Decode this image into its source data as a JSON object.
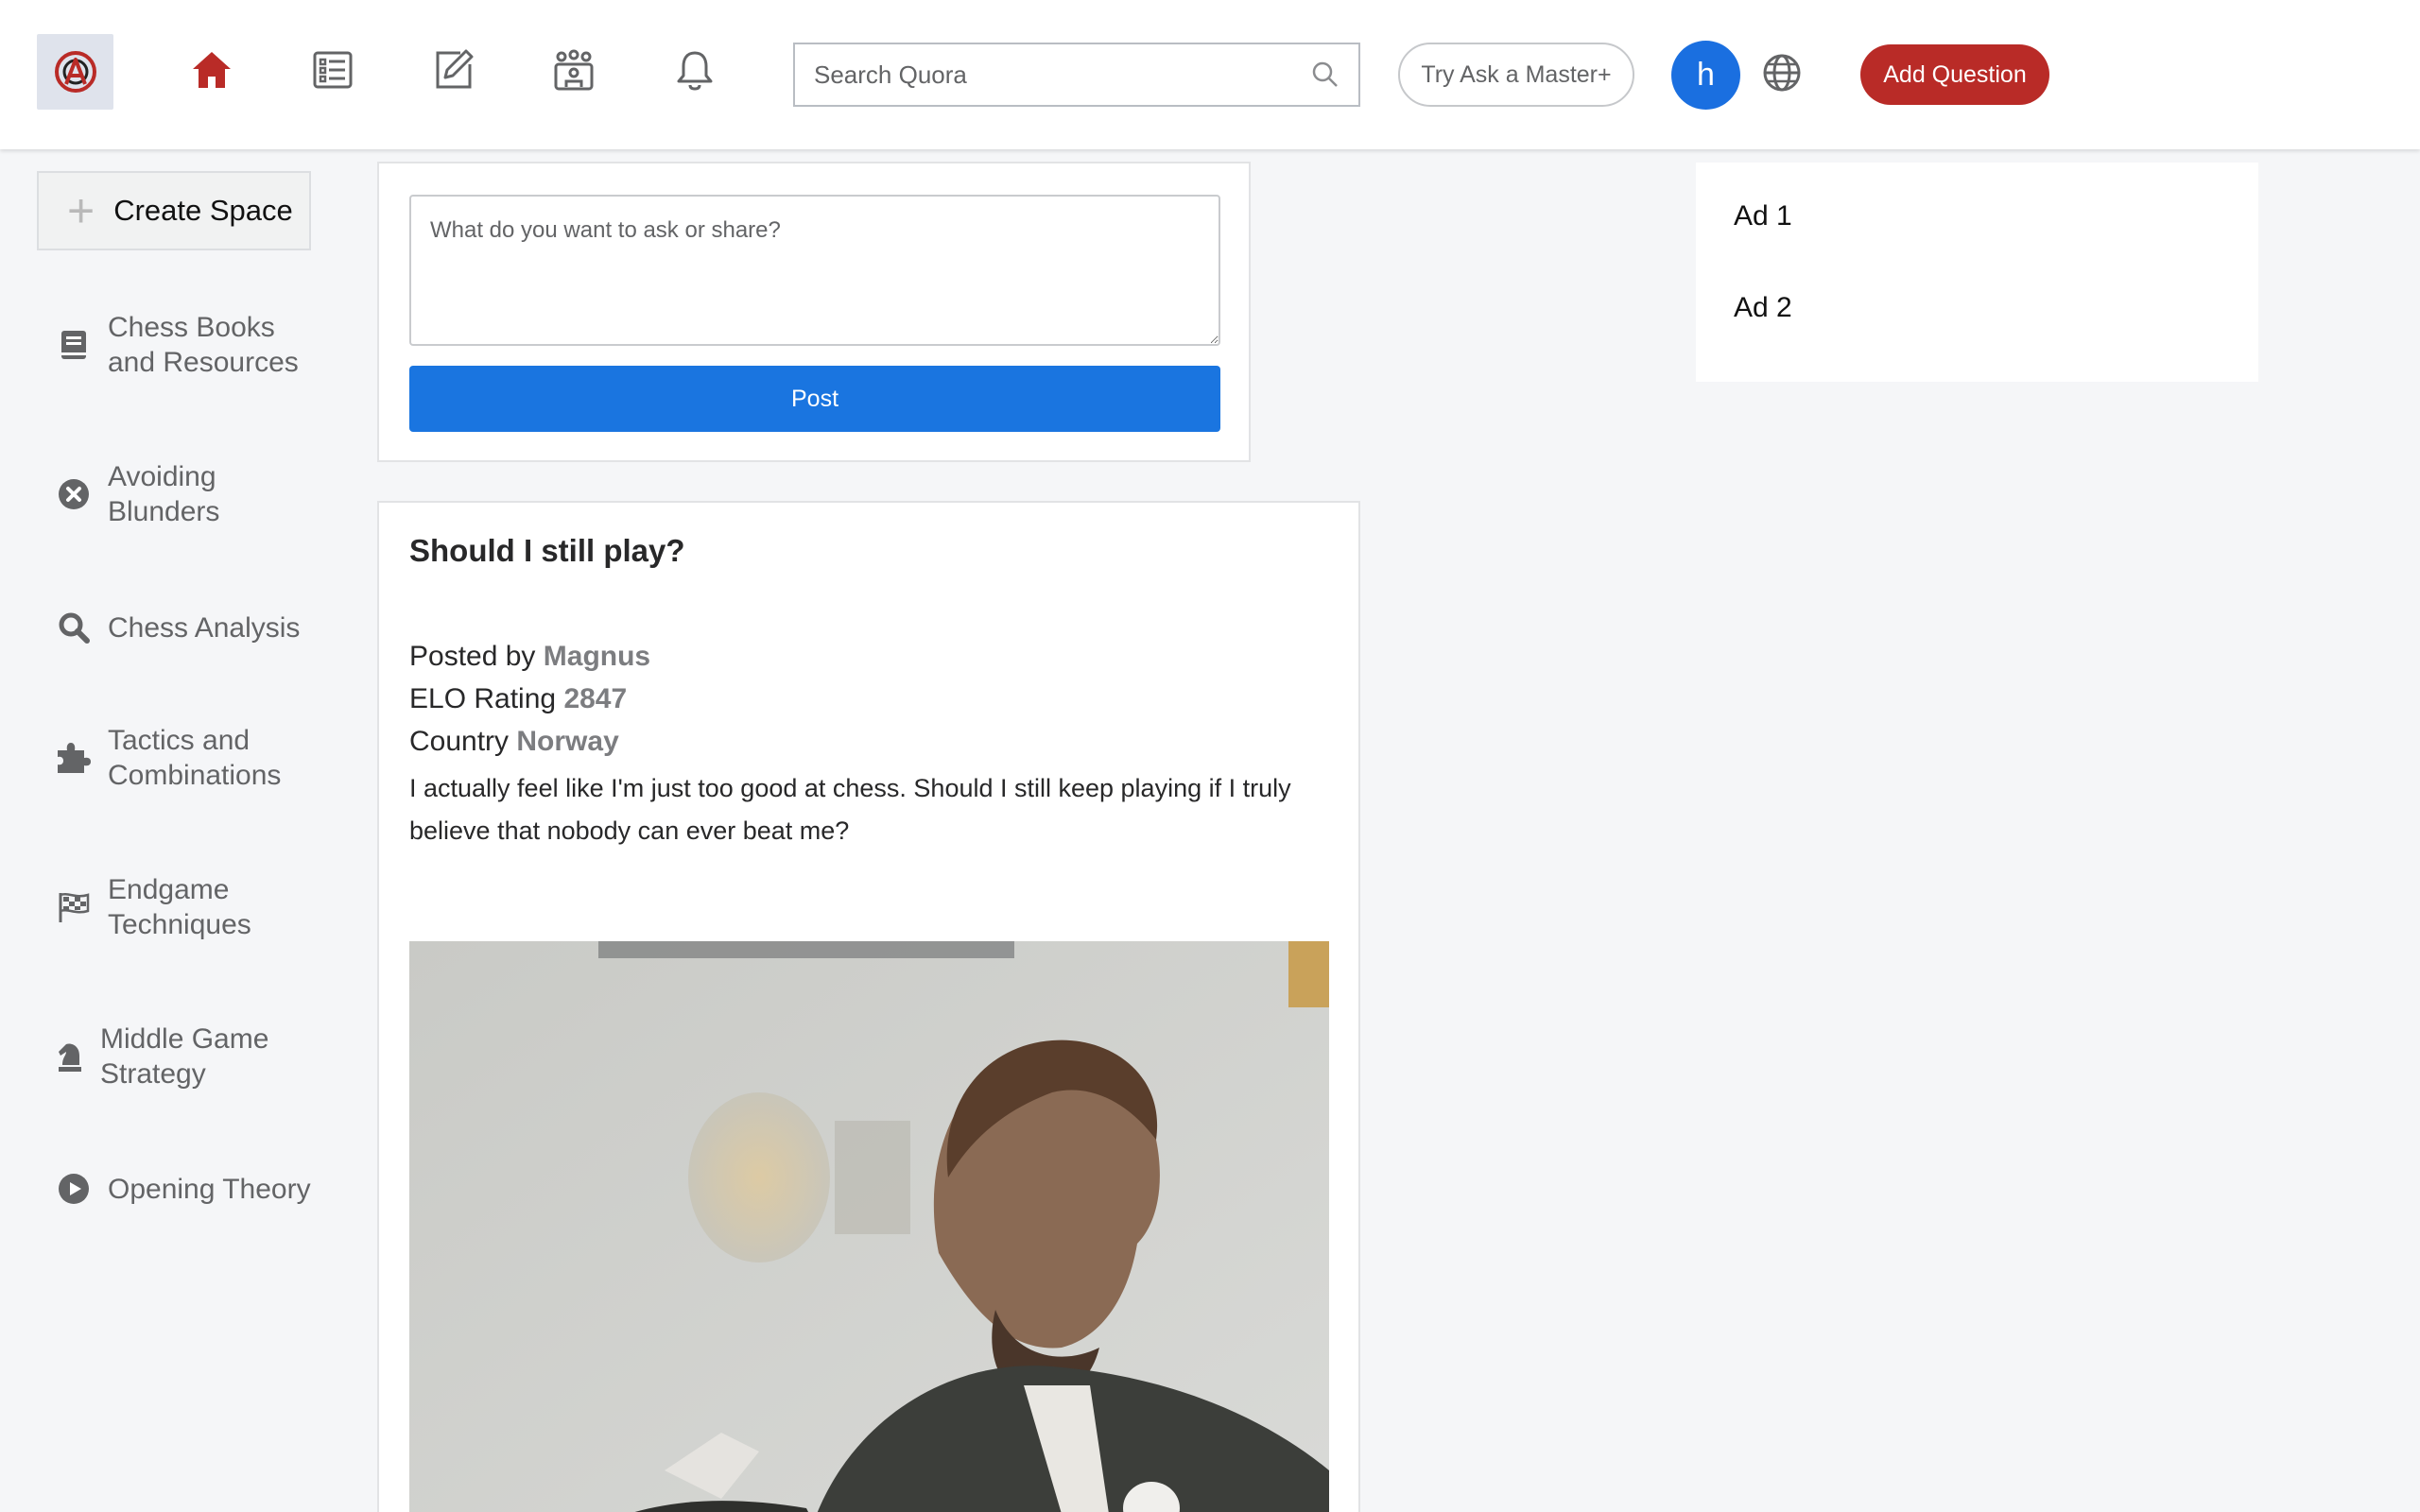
{
  "header": {
    "search_placeholder": "Search Quora",
    "try_label": "Try Ask a Master+",
    "avatar_initial": "h",
    "add_question_label": "Add Question",
    "brand_color": "#b92b27",
    "accent_color": "#1a75e0",
    "nav_icons": [
      "home-icon",
      "following-icon",
      "answer-icon",
      "spaces-icon",
      "notifications-icon"
    ]
  },
  "sidebar": {
    "create_space_label": "Create Space",
    "items": [
      {
        "label_line1": "Chess Books",
        "label_line2": "and Resources",
        "icon": "book-icon"
      },
      {
        "label_line1": "Avoiding",
        "label_line2": "Blunders",
        "icon": "x-circle-icon"
      },
      {
        "label_line1": "Chess Analysis",
        "label_line2": "",
        "icon": "magnifier-icon"
      },
      {
        "label_line1": "Tactics and",
        "label_line2": "Combinations",
        "icon": "puzzle-icon"
      },
      {
        "label_line1": "Endgame",
        "label_line2": "Techniques",
        "icon": "checkered-flag-icon"
      },
      {
        "label_line1": "Middle Game",
        "label_line2": "Strategy",
        "icon": "chess-knight-icon"
      },
      {
        "label_line1": "Opening Theory",
        "label_line2": "",
        "icon": "play-circle-icon"
      }
    ]
  },
  "composer": {
    "placeholder": "What do you want to ask or share?",
    "post_label": "Post"
  },
  "post": {
    "title": "Should I still play?",
    "posted_by_label": "Posted by",
    "author": "Magnus",
    "elo_label": "ELO Rating",
    "elo": "2847",
    "country_label": "Country",
    "country": "Norway",
    "body": "I actually feel like I'm just too good at chess. Should I still keep playing if I truly believe that nobody can ever beat me?"
  },
  "ads": {
    "ad1": "Ad 1",
    "ad2": "Ad 2"
  }
}
